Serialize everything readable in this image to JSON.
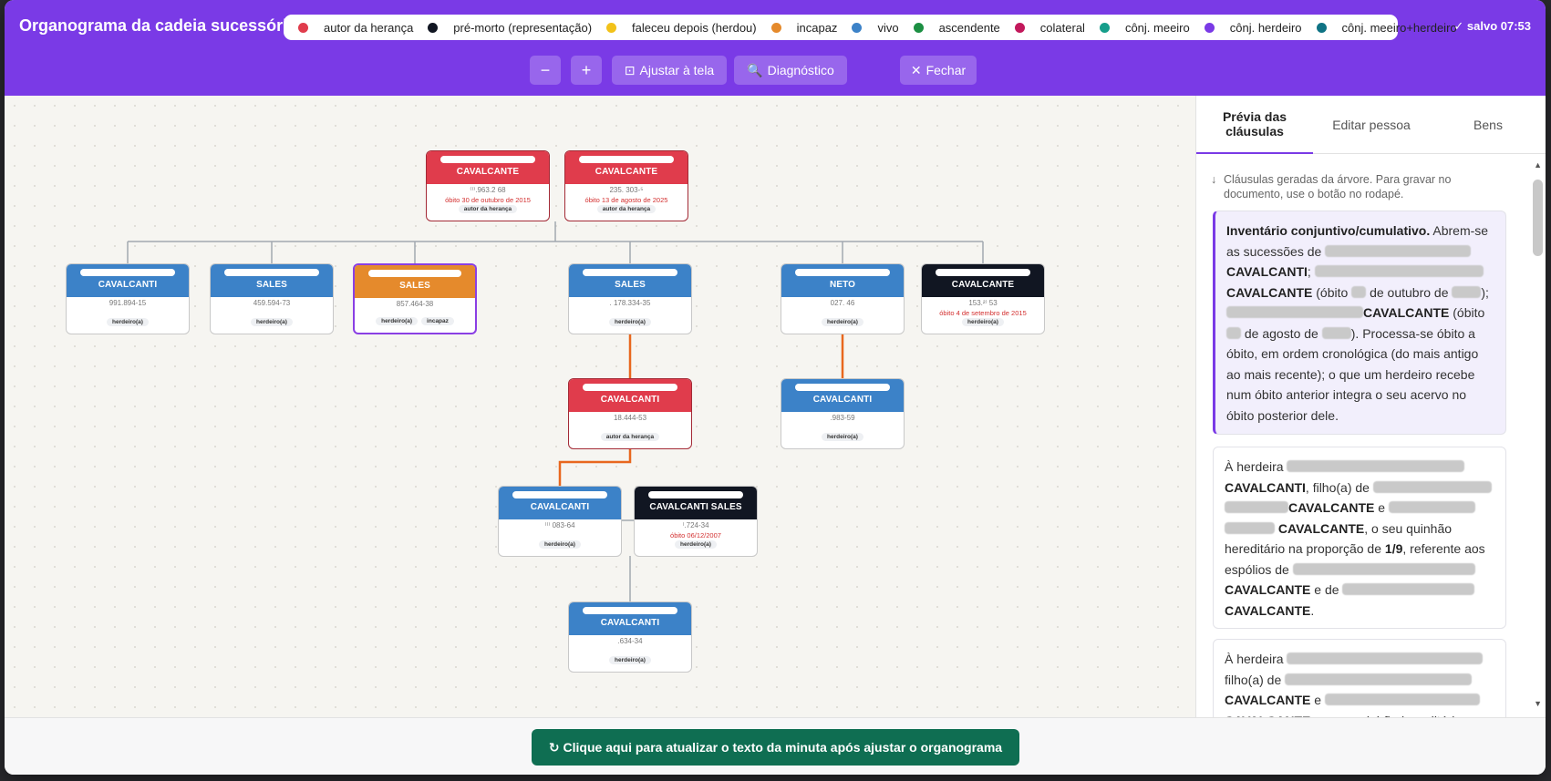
{
  "title": "Organograma da cadeia sucessória",
  "saved": "✓ salvo 07:53",
  "legend": [
    {
      "label": "autor da herança",
      "color": "#e03c4c"
    },
    {
      "label": "pré-morto (representação)",
      "color": "#111622"
    },
    {
      "label": "faleceu depois (herdou)",
      "color": "#f2c21a"
    },
    {
      "label": "incapaz",
      "color": "#e58a2c"
    },
    {
      "label": "vivo",
      "color": "#3c82c8"
    },
    {
      "label": "ascendente",
      "color": "#1c8f43"
    },
    {
      "label": "colateral",
      "color": "#c2185b"
    },
    {
      "label": "cônj. meeiro",
      "color": "#169e8b"
    },
    {
      "label": "cônj. herdeiro",
      "color": "#7a3ae6"
    },
    {
      "label": "cônj. meeiro+herdeiro",
      "color": "#0f7384"
    }
  ],
  "toolbar": {
    "zoom_out": "−",
    "zoom_in": "+",
    "fit": "Ajustar à tela",
    "fit_icon": "⊡",
    "diag": "Diagnóstico",
    "diag_icon": "🔍",
    "close": "Fechar",
    "close_icon": "✕"
  },
  "nodes": [
    {
      "name": "CAVALCANTE",
      "doc": "⁽⁾⁾.963.2   68",
      "death": "óbito 30 de outubro de 2015",
      "tags": [
        "autor da herança"
      ],
      "color": "red"
    },
    {
      "name": "CAVALCANTE",
      "doc": "235.      303-⁵",
      "death": "óbito 13 de agosto de 2025",
      "tags": [
        "autor da herança"
      ],
      "color": "red"
    },
    {
      "name": "CAVALCANTI",
      "doc": "991.894-15",
      "death": "",
      "tags": [
        "herdeiro(a)"
      ],
      "color": "blue"
    },
    {
      "name": "SALES",
      "doc": "459.594-73",
      "death": "",
      "tags": [
        "herdeiro(a)"
      ],
      "color": "blue"
    },
    {
      "name": "SALES",
      "doc": "857.464-38",
      "death": "",
      "tags": [
        "herdeiro(a)",
        "incapaz"
      ],
      "color": "orange"
    },
    {
      "name": "SALES",
      "doc": ". 178.334-35",
      "death": "",
      "tags": [
        "herdeiro(a)"
      ],
      "color": "blue"
    },
    {
      "name": "NETO",
      "doc": "027.           46",
      "death": "",
      "tags": [
        "herdeiro(a)"
      ],
      "color": "blue"
    },
    {
      "name": "CAVALCANTE",
      "doc": "153.²⁾      53",
      "death": "óbito 4 de setembro de 2015",
      "tags": [
        "herdeiro(a)"
      ],
      "color": "black"
    },
    {
      "name": "CAVALCANTI",
      "doc": "18.444-53",
      "death": "",
      "tags": [
        "autor da herança"
      ],
      "color": "red"
    },
    {
      "name": "CAVALCANTI",
      "doc": ".983-59",
      "death": "",
      "tags": [
        "herdeiro(a)"
      ],
      "color": "blue"
    },
    {
      "name": "CAVALCANTI",
      "doc": "⁾⁾⁾      083-64",
      "death": "",
      "tags": [
        "herdeiro(a)"
      ],
      "color": "blue"
    },
    {
      "name": "CAVALCANTI SALES",
      "doc": "⁾.724-34",
      "death": "óbito 06/12/2007",
      "tags": [
        "herdeiro(a)"
      ],
      "color": "black"
    },
    {
      "name": "CAVALCANTI",
      "doc": ".634-34",
      "death": "",
      "tags": [
        "herdeiro(a)"
      ],
      "color": "blue"
    }
  ],
  "panel": {
    "tabs": [
      "Prévia das cláusulas",
      "Editar pessoa",
      "Bens"
    ],
    "note_arrow": "↓",
    "note": "Cláusulas geradas da árvore. Para gravar no documento, use o botão no rodapé.",
    "card1": {
      "bold": "Inventário conjuntivo/cumulativo.",
      "t1": " Abrem-se as sucessões de ",
      "n1": "CAVALCANTI",
      "n2": "CAVALCANTE",
      "t2": " (óbito ",
      "t3": " de outubro de ",
      "t4": ");",
      "n3": "CAVALCANTE",
      "t5": " (óbito ",
      "t6": " de agosto de ",
      "t7": "). Processa-se óbito a óbito, em ordem cronológica (do mais antigo ao mais recente); o que um herdeiro recebe num óbito anterior integra o seu acervo no óbito posterior dele."
    },
    "card2": {
      "t1": "À herdeira ",
      "n1": "CAVALCANTI",
      "t2": ", filho(a) de ",
      "n2": "CAVALCANTE",
      "t3": " e ",
      "n3": "CAVALCANTE",
      "t4": ", o seu quinhão hereditário na proporção de ",
      "frac": "1/9",
      "t5": ", referente aos espólios de ",
      "n4": "CAVALCANTE",
      "t6": " e de ",
      "n5": "CAVALCANTE",
      "t7": "."
    },
    "card3": {
      "t1": "À herdeira ",
      "t2": "filho(a) de ",
      "n1": "CAVALCANTE",
      "t3": " e ",
      "n2": "CAVALCANTE",
      "t4": ", o seu quinhão hereditário na"
    }
  },
  "footer_button": "↻ Clique aqui para atualizar o texto da minuta após ajustar o organograma"
}
